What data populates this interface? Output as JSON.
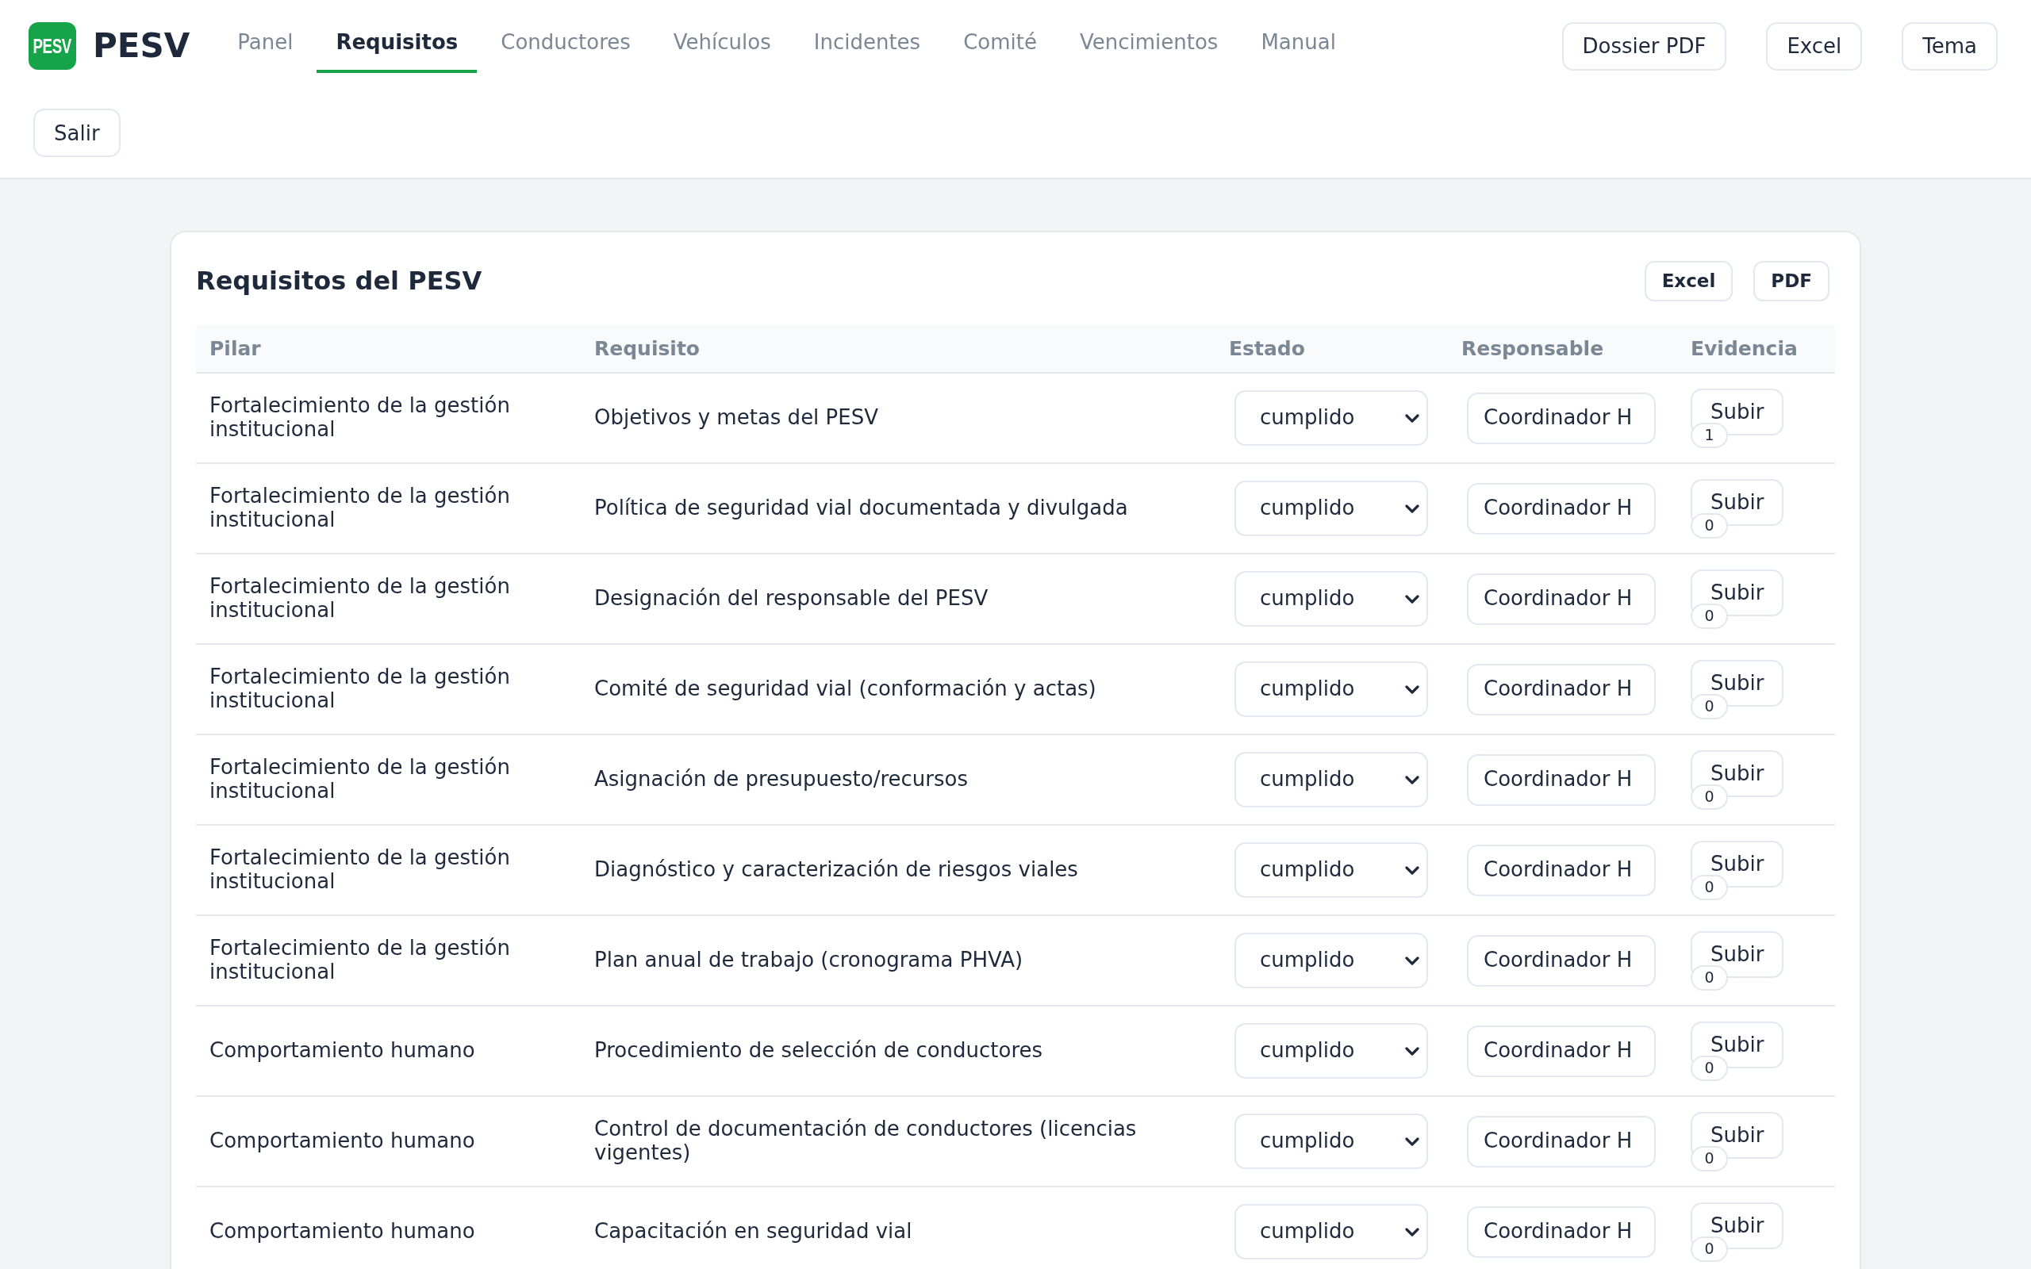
{
  "app": {
    "logo_text": "PESV",
    "title": "PESV"
  },
  "nav_tabs": [
    {
      "label": "Panel",
      "selected": false
    },
    {
      "label": "Requisitos",
      "selected": true
    },
    {
      "label": "Conductores",
      "selected": false
    },
    {
      "label": "Vehículos",
      "selected": false
    },
    {
      "label": "Incidentes",
      "selected": false
    },
    {
      "label": "Comité",
      "selected": false
    },
    {
      "label": "Vencimientos",
      "selected": false
    },
    {
      "label": "Manual",
      "selected": false
    }
  ],
  "header_buttons": [
    "Dossier PDF",
    "Excel",
    "Tema"
  ],
  "logout_button": "Salir",
  "card": {
    "title": "Requisitos del PESV",
    "buttons": [
      "Excel",
      "PDF"
    ],
    "table": {
      "columns": [
        "Pilar",
        "Requisito",
        "Estado",
        "Responsable",
        "Evidencia"
      ],
      "rows": [
        {
          "pilar": "Fortalecimiento de la gestión institucional",
          "requisito": "Objetivos y metas del PESV",
          "estado": "cumplido",
          "responsable": "Coordinador H",
          "upload_button": "Subir",
          "evidence_count": "1"
        },
        {
          "pilar": "Fortalecimiento de la gestión institucional",
          "requisito": "Política de seguridad vial documentada y divulgada",
          "estado": "cumplido",
          "responsable": "Coordinador H",
          "upload_button": "Subir",
          "evidence_count": "0"
        },
        {
          "pilar": "Fortalecimiento de la gestión institucional",
          "requisito": "Designación del responsable del PESV",
          "estado": "cumplido",
          "responsable": "Coordinador H",
          "upload_button": "Subir",
          "evidence_count": "0"
        },
        {
          "pilar": "Fortalecimiento de la gestión institucional",
          "requisito": "Comité de seguridad vial (conformación y actas)",
          "estado": "cumplido",
          "responsable": "Coordinador H",
          "upload_button": "Subir",
          "evidence_count": "0"
        },
        {
          "pilar": "Fortalecimiento de la gestión institucional",
          "requisito": "Asignación de presupuesto/recursos",
          "estado": "cumplido",
          "responsable": "Coordinador H",
          "upload_button": "Subir",
          "evidence_count": "0"
        },
        {
          "pilar": "Fortalecimiento de la gestión institucional",
          "requisito": "Diagnóstico y caracterización de riesgos viales",
          "estado": "cumplido",
          "responsable": "Coordinador H",
          "upload_button": "Subir",
          "evidence_count": "0"
        },
        {
          "pilar": "Fortalecimiento de la gestión institucional",
          "requisito": "Plan anual de trabajo (cronograma PHVA)",
          "estado": "cumplido",
          "responsable": "Coordinador H",
          "upload_button": "Subir",
          "evidence_count": "0"
        },
        {
          "pilar": "Comportamiento humano",
          "requisito": "Procedimiento de selección de conductores",
          "estado": "cumplido",
          "responsable": "Coordinador H",
          "upload_button": "Subir",
          "evidence_count": "0"
        },
        {
          "pilar": "Comportamiento humano",
          "requisito": "Control de documentación de conductores (licencias vigentes)",
          "estado": "cumplido",
          "responsable": "Coordinador H",
          "upload_button": "Subir",
          "evidence_count": "0"
        },
        {
          "pilar": "Comportamiento humano",
          "requisito": "Capacitación en seguridad vial",
          "estado": "cumplido",
          "responsable": "Coordinador H",
          "upload_button": "Subir",
          "evidence_count": "0"
        }
      ]
    }
  }
}
